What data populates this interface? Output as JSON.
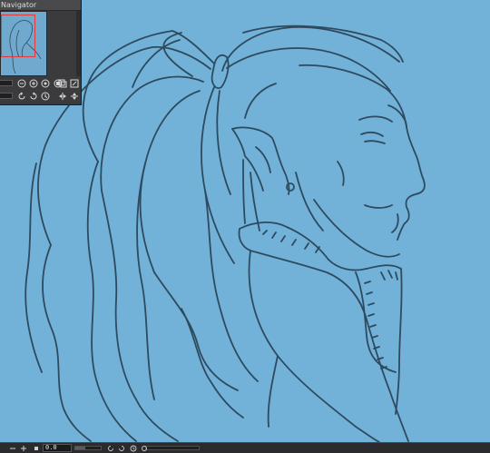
{
  "navigator": {
    "title": "Navigator",
    "viewport_color": "#e03a3a",
    "zoom_slider_level": 0.5,
    "rotate_slider_level": 0.5,
    "buttons_row1": [
      "zoom-out-icon",
      "zoom-in-icon",
      "fit-to-screen-icon",
      "stop-icon",
      "layers-copy-icon",
      "fit-window-icon"
    ],
    "buttons_row2": [
      "rotate-left-icon",
      "rotate-right-icon",
      "reset-rotation-icon",
      "flip-horizontal-icon",
      "flip-vertical-icon"
    ]
  },
  "canvas": {
    "background": "#72b2d8",
    "line_color": "#2e4a5e"
  },
  "statusbar": {
    "zoom_value": "0.0",
    "icons": [
      "minus-icon",
      "plus-icon",
      "square-icon",
      "rotate-left-icon",
      "rotate-right-icon",
      "clock-icon",
      "circle-icon"
    ]
  }
}
